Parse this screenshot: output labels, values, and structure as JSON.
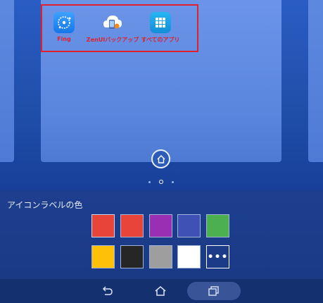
{
  "apps": [
    {
      "label": "Fing",
      "icon": "fing-app-icon"
    },
    {
      "label": "ZenUIバックアップ",
      "icon": "cloud-backup-app-icon"
    },
    {
      "label": "すべてのアプリ",
      "icon": "all-apps-grid-icon"
    }
  ],
  "highlight_color": "#e0202a",
  "page_indicator": {
    "count": 3,
    "active": 2
  },
  "panel": {
    "title": "アイコンラベルの色",
    "swatches": [
      {
        "color": "#e8443a",
        "selected": true
      },
      {
        "color": "#e8443a"
      },
      {
        "color": "#9b2fb4"
      },
      {
        "color": "#3f51b5"
      },
      {
        "color": "#4caf50"
      },
      {
        "color": "#ffc107"
      },
      {
        "color": "#262626"
      },
      {
        "color": "#9e9e9e"
      },
      {
        "color": "#ffffff"
      }
    ],
    "more_label": "•••"
  },
  "nav": {
    "back": "back-arrow-icon",
    "home": "home-outline-icon",
    "recent": "recent-apps-icon"
  }
}
